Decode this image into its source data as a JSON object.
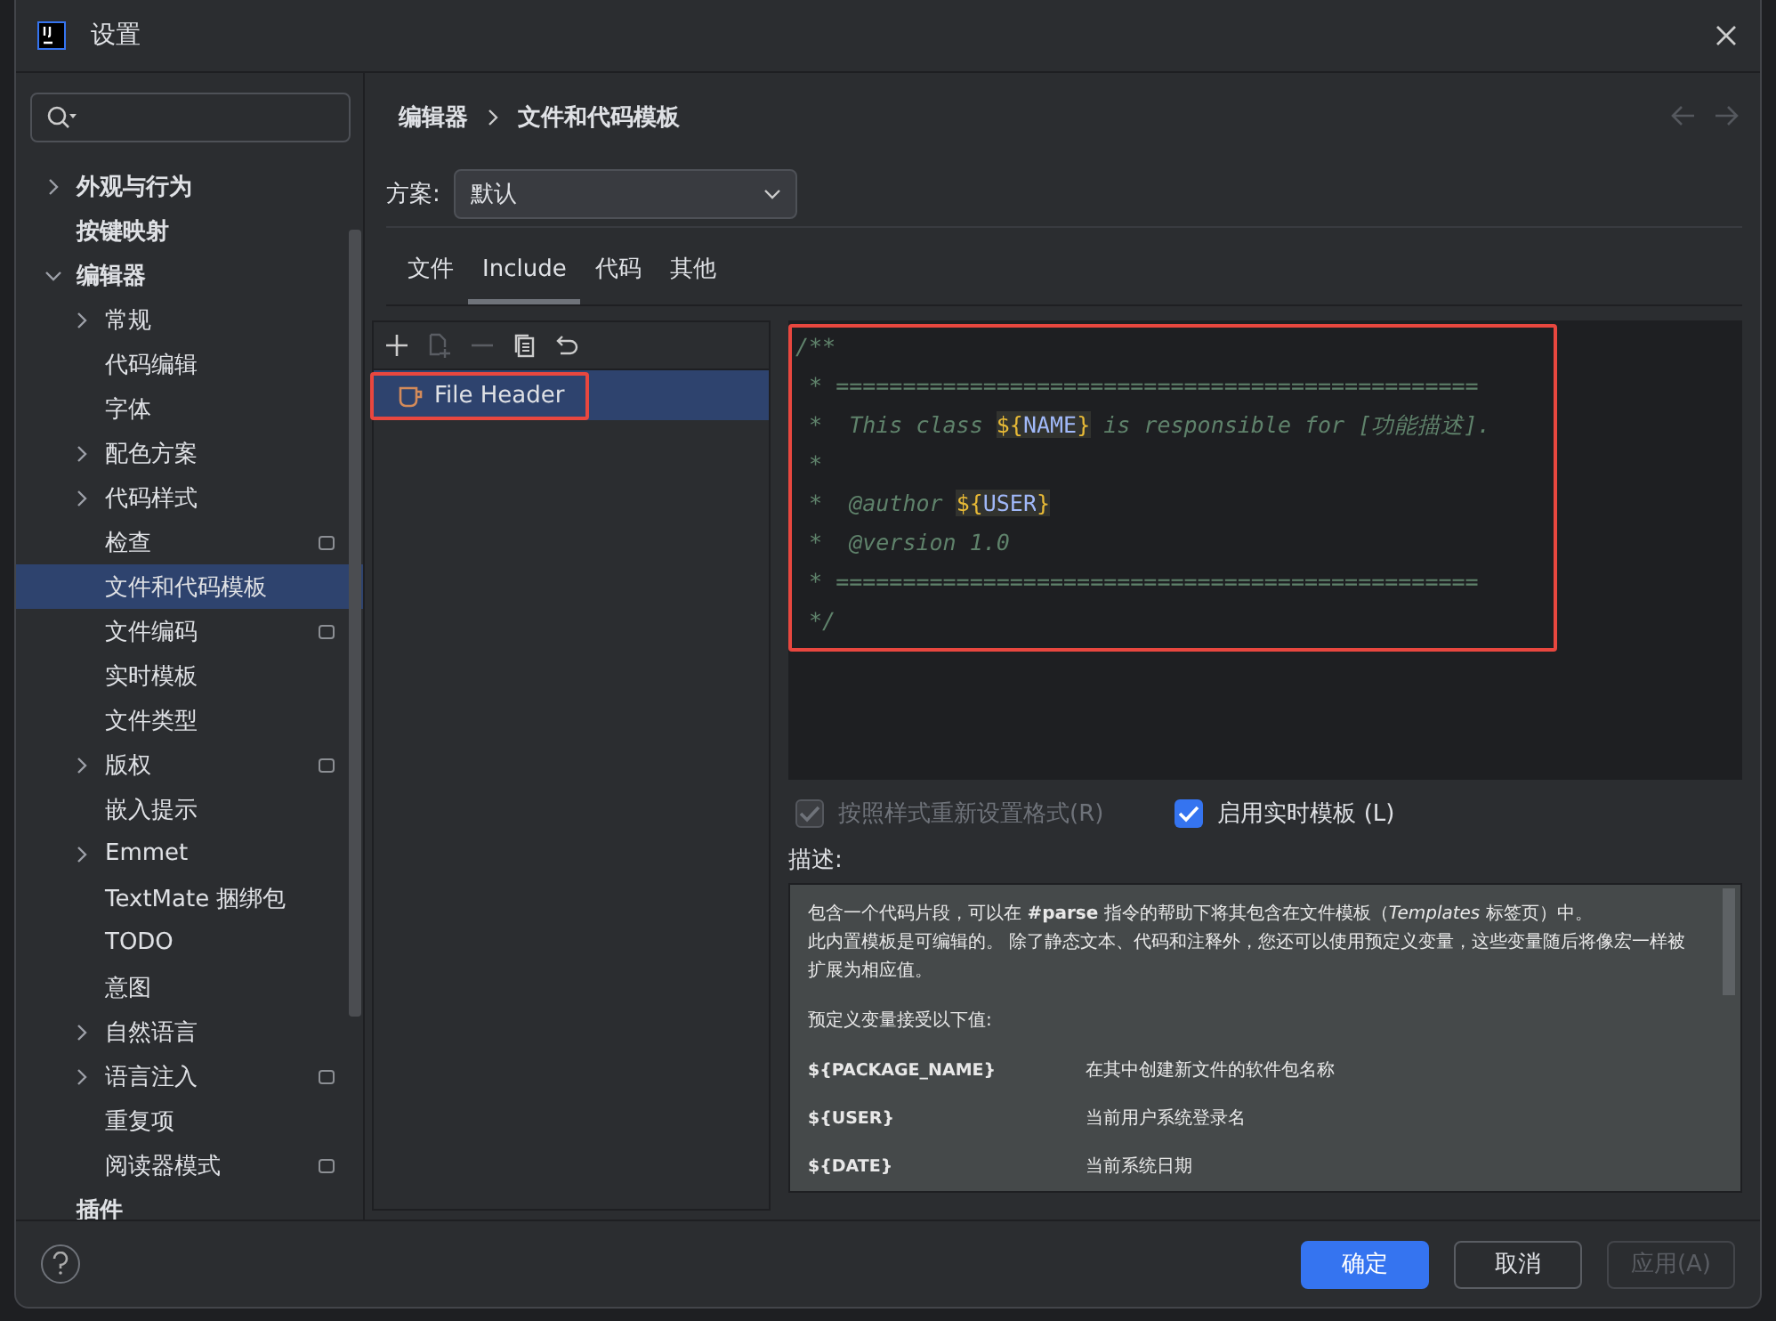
{
  "window": {
    "title": "设置"
  },
  "sidebar": {
    "items": [
      {
        "label": "外观与行为",
        "expanded": false,
        "selected": false,
        "scope_icon": false
      },
      {
        "label": "按键映射",
        "selected": false,
        "scope_icon": false
      },
      {
        "label": "编辑器",
        "expanded": true,
        "selected": false,
        "scope_icon": false,
        "children": [
          {
            "label": "常规",
            "expanded": false,
            "selected": false,
            "scope_icon": false
          },
          {
            "label": "代码编辑",
            "selected": false,
            "scope_icon": false
          },
          {
            "label": "字体",
            "selected": false,
            "scope_icon": false
          },
          {
            "label": "配色方案",
            "expanded": false,
            "selected": false,
            "scope_icon": false
          },
          {
            "label": "代码样式",
            "expanded": false,
            "selected": false,
            "scope_icon": false
          },
          {
            "label": "检查",
            "selected": false,
            "scope_icon": true
          },
          {
            "label": "文件和代码模板",
            "selected": true,
            "scope_icon": false
          },
          {
            "label": "文件编码",
            "selected": false,
            "scope_icon": true
          },
          {
            "label": "实时模板",
            "selected": false,
            "scope_icon": false
          },
          {
            "label": "文件类型",
            "selected": false,
            "scope_icon": false
          },
          {
            "label": "版权",
            "expanded": false,
            "selected": false,
            "scope_icon": true
          },
          {
            "label": "嵌入提示",
            "selected": false,
            "scope_icon": false
          },
          {
            "label": "Emmet",
            "expanded": false,
            "selected": false,
            "scope_icon": false
          },
          {
            "label": "TextMate 捆绑包",
            "selected": false,
            "scope_icon": false
          },
          {
            "label": "TODO",
            "selected": false,
            "scope_icon": false
          },
          {
            "label": "意图",
            "selected": false,
            "scope_icon": false
          },
          {
            "label": "自然语言",
            "expanded": false,
            "selected": false,
            "scope_icon": false
          },
          {
            "label": "语言注入",
            "expanded": false,
            "selected": false,
            "scope_icon": true
          },
          {
            "label": "重复项",
            "selected": false,
            "scope_icon": false
          },
          {
            "label": "阅读器模式",
            "selected": false,
            "scope_icon": true
          }
        ]
      },
      {
        "label": "插件",
        "selected": false,
        "scope_icon": false
      }
    ]
  },
  "breadcrumb": [
    "编辑器",
    "文件和代码模板"
  ],
  "scheme": {
    "label": "方案:",
    "value": "默认"
  },
  "tabs": [
    {
      "label": "文件",
      "selected": false
    },
    {
      "label": "Include",
      "selected": true
    },
    {
      "label": "代码",
      "selected": false
    },
    {
      "label": "其他",
      "selected": false
    }
  ],
  "templates": [
    {
      "label": "File Header",
      "selected": true,
      "highlighted": true
    }
  ],
  "code": {
    "highlighted": true,
    "lines": [
      [
        {
          "kind": "comment",
          "text": "/**"
        }
      ],
      [
        {
          "kind": "comment",
          "text": " * ================================================"
        }
      ],
      [
        {
          "kind": "comment",
          "text": " *  This class "
        },
        {
          "kind": "brace",
          "text": "${"
        },
        {
          "kind": "var",
          "text": "NAME"
        },
        {
          "kind": "brace",
          "text": "}"
        },
        {
          "kind": "comment",
          "text": " is responsible for [功能描述]."
        }
      ],
      [
        {
          "kind": "comment",
          "text": " *"
        }
      ],
      [
        {
          "kind": "comment",
          "text": " *  @author "
        },
        {
          "kind": "brace",
          "text": "${"
        },
        {
          "kind": "var",
          "text": "USER"
        },
        {
          "kind": "brace",
          "text": "}"
        }
      ],
      [
        {
          "kind": "comment",
          "text": " *  @version 1.0"
        }
      ],
      [
        {
          "kind": "comment",
          "text": " * ================================================"
        }
      ],
      [
        {
          "kind": "comment",
          "text": " */"
        }
      ]
    ]
  },
  "options": [
    {
      "label": "按照样式重新设置格式(R)",
      "checked": true,
      "disabled": true
    },
    {
      "label": "启用实时模板 (L)",
      "checked": true,
      "disabled": false
    }
  ],
  "description": {
    "label": "描述:",
    "paragraphs": [
      [
        "包含一个代码片段，可以在 **#parse** 指令的帮助下将其包含在文件模板（*Templates* 标签页）中。",
        "此内置模板是可编辑的。 除了静态文本、代码和注释外，您还可以使用预定义变量，这些变量随后将像宏一样被扩展为相应值。"
      ],
      [
        "预定义变量接受以下值:"
      ]
    ],
    "variables": [
      {
        "name": "${PACKAGE_NAME}",
        "meaning": "在其中创建新文件的软件包名称"
      },
      {
        "name": "${USER}",
        "meaning": "当前用户系统登录名"
      },
      {
        "name": "${DATE}",
        "meaning": "当前系统日期"
      }
    ]
  },
  "buttons": [
    {
      "label": "确定",
      "kind": "primary",
      "disabled": false
    },
    {
      "label": "取消",
      "kind": "normal",
      "disabled": false
    },
    {
      "label": "应用(A)",
      "kind": "normal",
      "disabled": true
    }
  ]
}
